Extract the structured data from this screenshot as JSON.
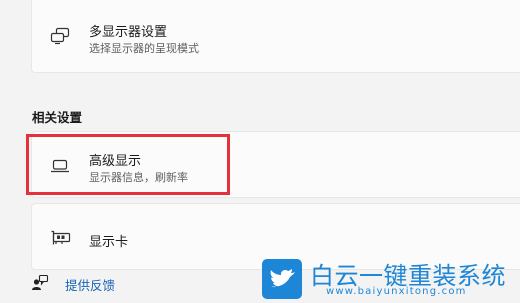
{
  "multi_display": {
    "title": "多显示器设置",
    "subtitle": "选择显示器的呈现模式",
    "icon": "multi-display-icon"
  },
  "related_settings": {
    "header": "相关设置",
    "items": [
      {
        "title": "高级显示",
        "subtitle": "显示器信息，刷新率",
        "icon": "monitor-icon"
      },
      {
        "title": "显示卡",
        "icon": "graphics-card-icon"
      }
    ]
  },
  "feedback": {
    "label": "提供反馈",
    "icon": "feedback-icon"
  },
  "watermark": {
    "title": "白云一键重装系统",
    "url": "www.baiyunxitong.com"
  },
  "colors": {
    "highlight": "#e3323b",
    "link": "#1a64b8",
    "brand": "#1e86d6"
  }
}
